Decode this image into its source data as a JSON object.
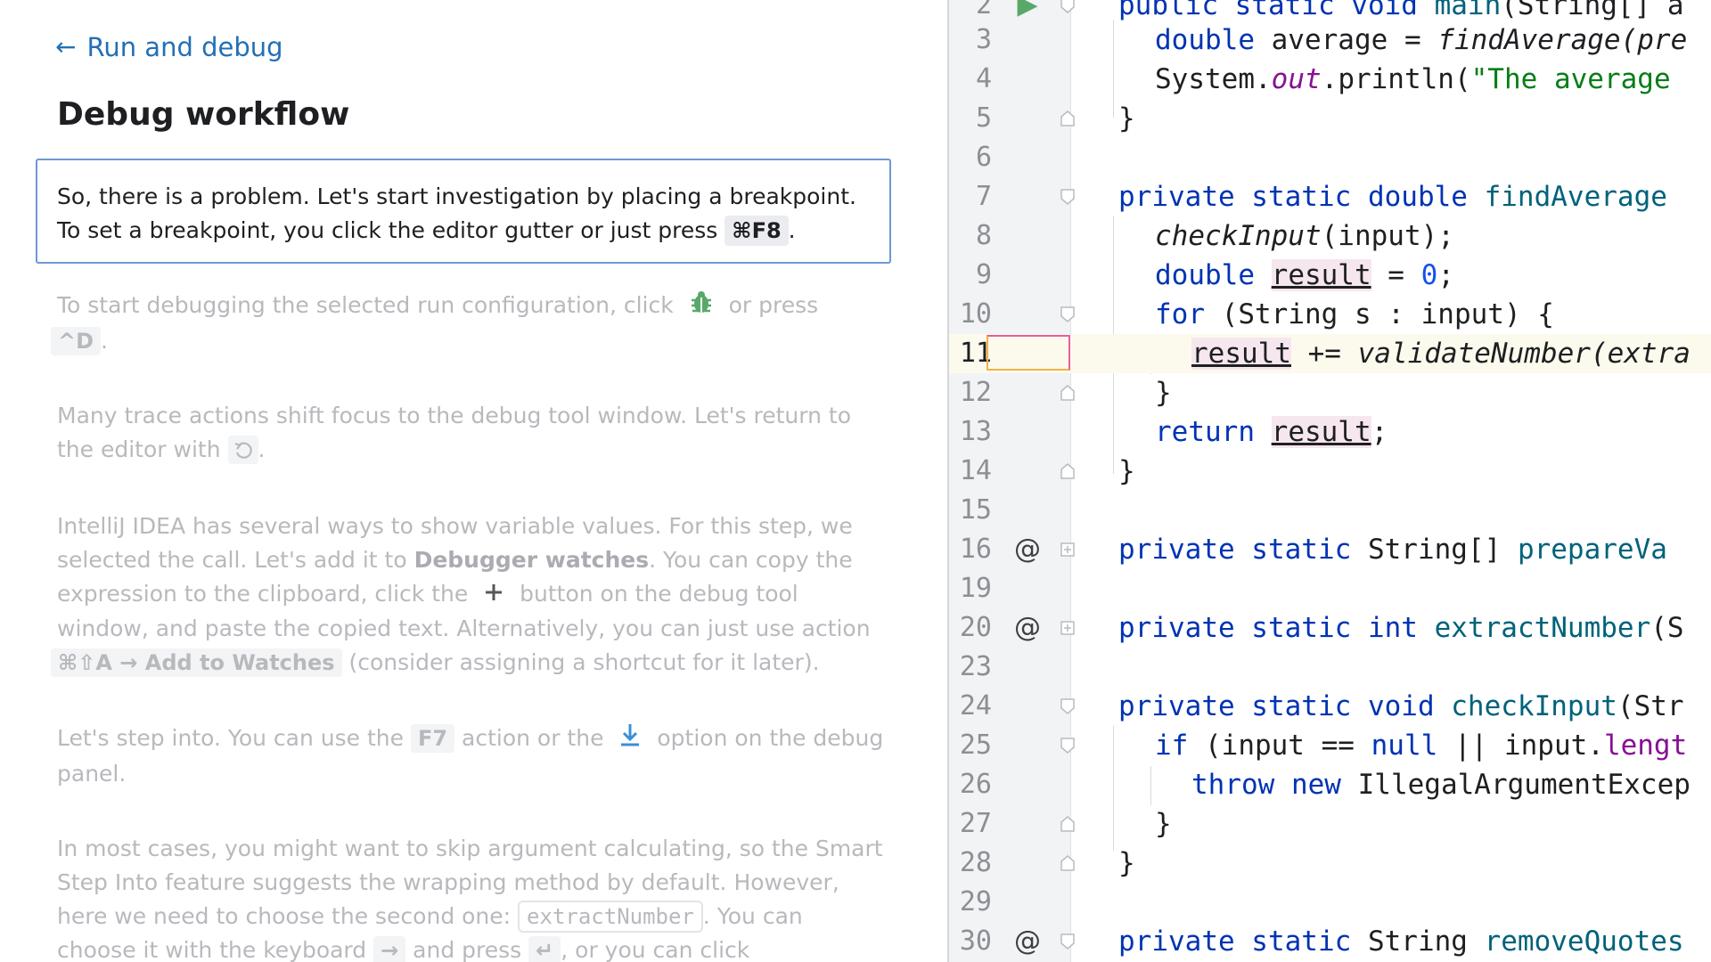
{
  "learn_panel": {
    "back_label": "Run and debug",
    "title": "Debug workflow",
    "current_step": {
      "text_1": "So, there is a problem. Let's start investigation by placing a breakpoint. To set a breakpoint, you click the editor gutter or just press",
      "shortcut": "⌘F8",
      "text_2": "."
    },
    "step_debug": {
      "text_1": "To start debugging the selected run configuration, click",
      "text_2": "or press",
      "shortcut": "^D",
      "text_3": "."
    },
    "step_return": {
      "text_1": "Many trace actions shift focus to the debug tool window. Let's return to the editor with",
      "text_2": "."
    },
    "step_watches": {
      "text_1": "IntelliJ IDEA has several ways to show variable values. For this step, we selected the call. Let's add it to",
      "bold": "Debugger watches",
      "text_2": ". You can copy the expression to the clipboard, click the",
      "text_3": "button on the debug tool window, and paste the copied text. Alternatively, you can just use action",
      "shortcut": "⌘⇧A → Add to Watches",
      "text_4": "(consider assigning a shortcut for it later)."
    },
    "step_into": {
      "text_1": "Let's step into. You can use the",
      "shortcut": "F7",
      "text_2": "action or the",
      "text_3": "option on the debug panel."
    },
    "step_smart": {
      "text_1": "In most cases, you might want to skip argument calculating, so the Smart Step Into feature suggests the wrapping method by default. However, here we need to choose the second one:",
      "code": "extractNumber",
      "text_2": ". You can choose it with the keyboard",
      "key_arrow": "→",
      "text_3": "and press",
      "key_enter": "↵",
      "text_4": ", or you can click"
    }
  },
  "editor": {
    "line_numbers": [
      "2",
      "3",
      "4",
      "5",
      "6",
      "7",
      "8",
      "9",
      "10",
      "11",
      "12",
      "13",
      "14",
      "15",
      "16",
      "19",
      "20",
      "23",
      "24",
      "25",
      "26",
      "27",
      "28",
      "29",
      "30"
    ],
    "current_line": "11",
    "lines": {
      "l2": [
        "public static void main(String[] a"
      ],
      "l3_a": "double",
      "l3_b": " average = ",
      "l3_c": "findAverage",
      "l3_d": "(pre",
      "l4_a": "System.",
      "l4_b": "out",
      "l4_c": ".println(",
      "l4_d": "\"The average",
      "l5": "}",
      "l7_a": "private static double",
      "l7_b": " findAverage",
      "l8_a": "checkInput",
      "l8_b": "(input);",
      "l9_a": "double",
      "l9_b": "result",
      "l9_c": " = ",
      "l9_d": "0",
      "l9_e": ";",
      "l10_a": "for",
      "l10_b": " (String s : input) {",
      "l11_a": "result",
      "l11_b": " += ",
      "l11_c": "validateNumber",
      "l11_d": "(extra",
      "l12": "}",
      "l13_a": "return",
      "l13_b": "result",
      "l13_c": ";",
      "l14": "}",
      "l16_a": "private static",
      "l16_b": " String[] ",
      "l16_c": "prepareVa",
      "l20_a": "private static int",
      "l20_b": " extractNumber",
      "l20_c": "(S",
      "l24_a": "private static void",
      "l24_b": " checkInput",
      "l24_c": "(Str",
      "l25_a": "if",
      "l25_b": " (input == ",
      "l25_c": "null",
      "l25_d": " || input.",
      "l25_e": "lengt",
      "l26_a": "throw new",
      "l26_b": " IllegalArgumentExcep",
      "l27": "}",
      "l28": "}",
      "l30_a": "private static",
      "l30_b": " String ",
      "l30_c": "removeQuotes"
    },
    "gutter_annotation": "@"
  },
  "colors": {
    "link": "#2270b6",
    "keyword": "#0033b3",
    "method": "#00627a",
    "string": "#067d17",
    "run_icon": "#59a869",
    "debug_icon": "#59a869"
  }
}
